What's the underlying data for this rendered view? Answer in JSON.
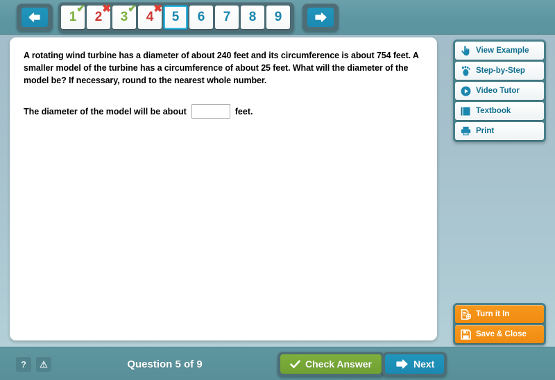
{
  "header": {
    "prev_button": {
      "name": "previous-question",
      "icon": "arrow-left-icon"
    },
    "next_button": {
      "name": "next-question",
      "icon": "arrow-right-icon"
    },
    "question_tiles": [
      {
        "number": "1",
        "state": "correct",
        "mark": "✔"
      },
      {
        "number": "2",
        "state": "incorrect",
        "mark": "✖"
      },
      {
        "number": "3",
        "state": "correct",
        "mark": "✔"
      },
      {
        "number": "4",
        "state": "incorrect",
        "mark": "✖"
      },
      {
        "number": "5",
        "state": "current",
        "mark": ""
      },
      {
        "number": "6",
        "state": "unanswered",
        "mark": ""
      },
      {
        "number": "7",
        "state": "unanswered",
        "mark": ""
      },
      {
        "number": "8",
        "state": "unanswered",
        "mark": ""
      },
      {
        "number": "9",
        "state": "unanswered",
        "mark": ""
      }
    ]
  },
  "question": {
    "body": "A rotating wind turbine has a diameter of about 240 feet and its circumference is about 754 feet. A smaller model of the turbine has a circumference of about 25 feet. What will the diameter of the model be? If necessary, round to the nearest whole number.",
    "answer_prefix": "The diameter of the model will be about",
    "answer_suffix": "feet.",
    "answer_value": "",
    "answer_placeholder": ""
  },
  "resources": [
    {
      "label": "View Example",
      "icon": "pointing-hand-icon"
    },
    {
      "label": "Step-by-Step",
      "icon": "footprint-icon"
    },
    {
      "label": "Video Tutor",
      "icon": "play-circle-icon"
    },
    {
      "label": "Textbook",
      "icon": "book-icon"
    },
    {
      "label": "Print",
      "icon": "printer-icon"
    }
  ],
  "submit_actions": [
    {
      "label": "Turn it In",
      "icon": "document-submit-icon"
    },
    {
      "label": "Save & Close",
      "icon": "floppy-disk-icon"
    }
  ],
  "footer": {
    "help_glyph": "?",
    "warning_glyph": "⚠",
    "counter": "Question 5 of 9",
    "check_answer_label": "Check Answer",
    "next_label": "Next"
  },
  "colors": {
    "header_teal": "#5b939e",
    "tray_dark": "#4d6e77",
    "accent_blue": "#1b89b1",
    "correct_green": "#7bb03b",
    "incorrect_red": "#cf3a36",
    "orange": "#f7981d",
    "check_green": "#7fb03c"
  }
}
